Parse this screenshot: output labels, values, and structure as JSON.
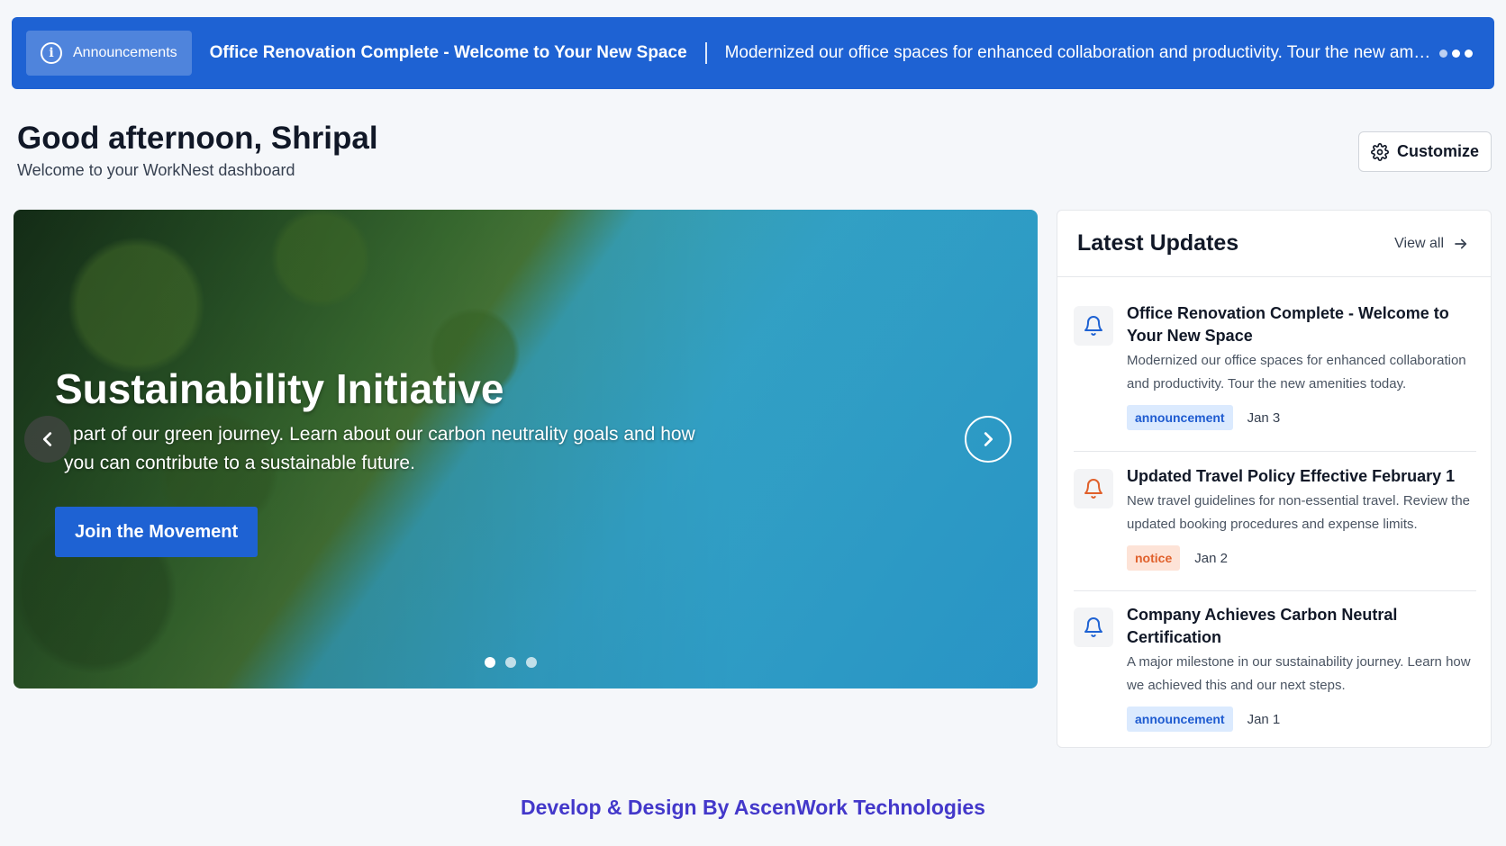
{
  "announcement_bar": {
    "label": "Announcements",
    "title": "Office Renovation Complete - Welcome to Your New Space",
    "text": "Modernized our office spaces for enhanced collaboration and productivity. Tour the new amenities tod...",
    "icon": "info-icon",
    "more_icon": "more-dots-icon"
  },
  "greeting": {
    "title": "Good afternoon, Shripal",
    "subtitle": "Welcome to your WorkNest dashboard"
  },
  "customize": {
    "label": "Customize",
    "icon": "gear-icon"
  },
  "hero": {
    "title": "Sustainability Initiative",
    "description_line1": "part of our green journey. Learn about our carbon neutrality goals and how",
    "description_line2": "you can contribute to a sustainable future.",
    "cta": "Join the Movement",
    "slides_count": 3,
    "active_slide": 1
  },
  "updates": {
    "title": "Latest Updates",
    "view_all": "View all",
    "items": [
      {
        "title": "Office Renovation Complete - Welcome to Your New Space",
        "description": "Modernized our office spaces for enhanced collaboration and productivity. Tour the new amenities today.",
        "tag": "announcement",
        "date": "Jan 3",
        "icon_color": "#1e62d3"
      },
      {
        "title": "Updated Travel Policy Effective February 1",
        "description": "New travel guidelines for non-essential travel. Review the updated booking procedures and expense limits.",
        "tag": "notice",
        "date": "Jan 2",
        "icon_color": "#e0602b"
      },
      {
        "title": "Company Achieves Carbon Neutral Certification",
        "description": "A major milestone in our sustainability journey. Learn how we achieved this and our next steps.",
        "tag": "announcement",
        "date": "Jan 1",
        "icon_color": "#1e62d3"
      }
    ]
  },
  "footer": {
    "text": "Develop & Design By AscenWork Technologies"
  }
}
